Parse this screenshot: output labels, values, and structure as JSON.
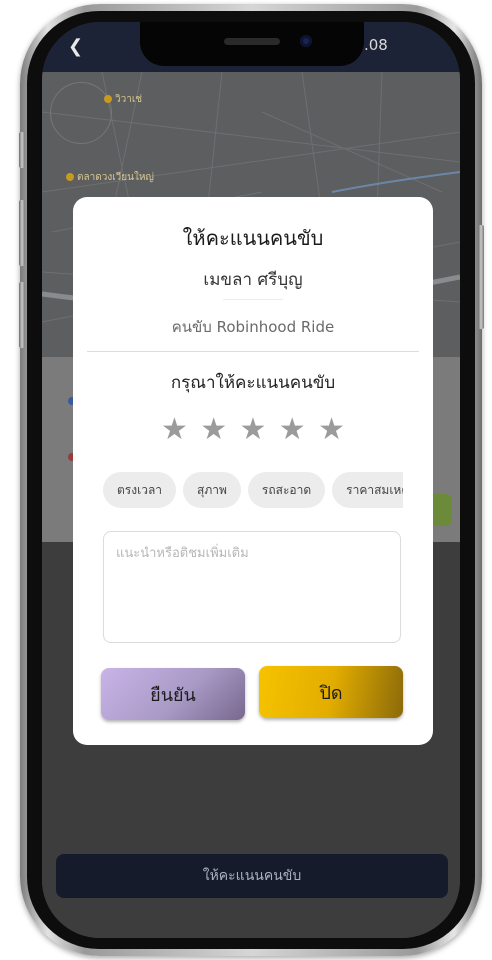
{
  "status_bar": {
    "back_icon": "chevron-left-icon",
    "time_fragment": ".08"
  },
  "map": {
    "labels": [
      "วิวาเช่",
      "ตลาดวงเวียนใหญ่"
    ],
    "label_color": "#c79a22"
  },
  "rating_modal": {
    "title": "ให้คะแนนคนขับ",
    "driver_name": "เมขลา ศรีบุญ",
    "driver_role": "คนขับ Robinhood Ride",
    "prompt": "กรุณาให้คะแนนคนขับ",
    "stars_total": 5,
    "stars_selected": 0,
    "star_icon": "star-icon",
    "tags": [
      "ตรงเวลา",
      "สุภาพ",
      "รถสะอาด",
      "ราคาสมเหตุสม"
    ],
    "comment_placeholder": "แนะนำหรือติชมเพิ่มเติม",
    "comment_value": "",
    "confirm_label": "ยืนยัน",
    "close_label": "ปิด"
  },
  "bottom_button_label": "ให้คะแนนคนขับ",
  "colors": {
    "confirm": "#b9a6d9",
    "close": "#f2bd00",
    "dark_navy": "#161b2b"
  }
}
